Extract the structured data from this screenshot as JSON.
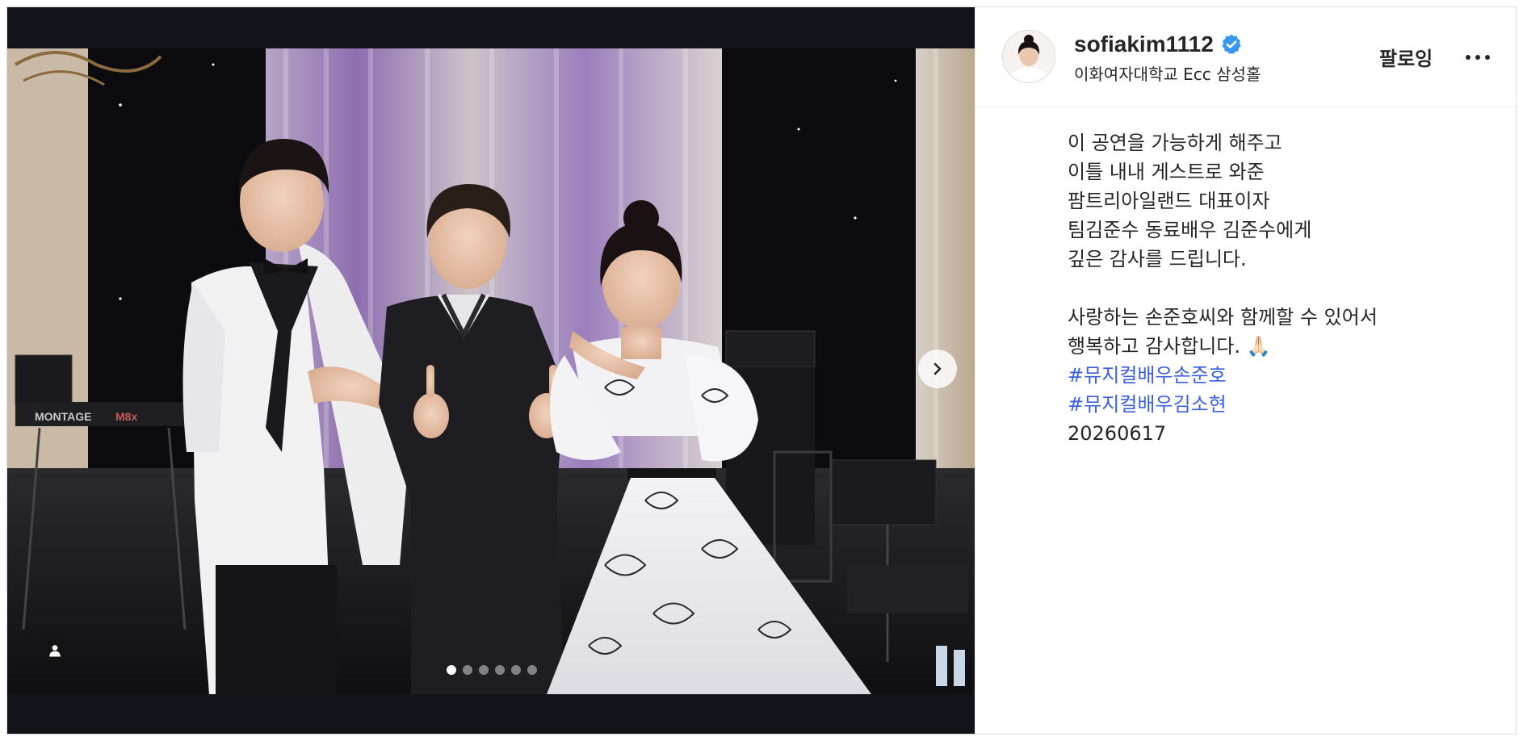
{
  "post": {
    "username": "sofiakim1112",
    "location": "이화여자대학교 Ecc 삼성홀",
    "follow_label": "팔로잉",
    "caption_lines": [
      "이 공연을 가능하게 해주고",
      "이틀 내내 게스트로 와준",
      "팜트리아일랜드 대표이자",
      "팀김준수 동료배우 김준수에게",
      "깊은 감사를 드립니다.",
      "사랑하는 손준호씨와 함께할 수 있어서",
      "행복하고 감사합니다. 🙏🏻"
    ],
    "hashtags": [
      "#뮤지컬배우손준호",
      "#뮤지컬배우김소현"
    ],
    "date_text": "20260617"
  },
  "carousel": {
    "slide_count": 6,
    "active_index": 0,
    "next_icon": "chevron-right-icon",
    "tag_icon": "person-icon"
  },
  "colors": {
    "hashtag": "#3b5fe0",
    "verified": "#3897f0",
    "text": "#262626"
  }
}
